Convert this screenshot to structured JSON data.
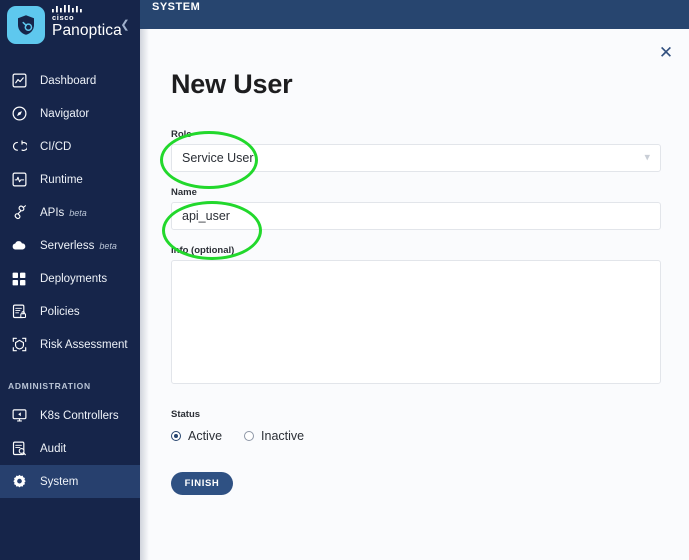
{
  "sidebar": {
    "brand": {
      "cisco_label": "cisco",
      "product_label": "Panoptica",
      "logo_icon": "shield-logo-icon",
      "collapse_icon": "chevron-left-icon"
    },
    "items": [
      {
        "label": "Dashboard",
        "icon": "dashboard-icon",
        "beta": "",
        "active": false
      },
      {
        "label": "Navigator",
        "icon": "compass-icon",
        "beta": "",
        "active": false
      },
      {
        "label": "CI/CD",
        "icon": "cicd-icon",
        "beta": "",
        "active": false
      },
      {
        "label": "Runtime",
        "icon": "runtime-monitor-icon",
        "beta": "",
        "active": false
      },
      {
        "label": "APIs",
        "icon": "api-plug-icon",
        "beta": "beta",
        "active": false
      },
      {
        "label": "Serverless",
        "icon": "cloud-icon",
        "beta": "beta",
        "active": false
      },
      {
        "label": "Deployments",
        "icon": "grid-squares-icon",
        "beta": "",
        "active": false
      },
      {
        "label": "Policies",
        "icon": "policy-lock-icon",
        "beta": "",
        "active": false
      },
      {
        "label": "Risk Assessment",
        "icon": "risk-scan-icon",
        "beta": "",
        "active": false
      }
    ],
    "section_label": "ADMINISTRATION",
    "admin_items": [
      {
        "label": "K8s Controllers",
        "icon": "k8s-monitor-icon",
        "beta": "",
        "active": false
      },
      {
        "label": "Audit",
        "icon": "audit-search-icon",
        "beta": "",
        "active": false
      },
      {
        "label": "System",
        "icon": "gear-icon",
        "beta": "",
        "active": true
      }
    ]
  },
  "topbar": {
    "title": "SYSTEM"
  },
  "panel": {
    "close_icon": "close-icon",
    "title": "New User"
  },
  "form": {
    "role": {
      "label": "Role",
      "value": "Service User",
      "chevron_icon": "chevron-down-icon"
    },
    "name": {
      "label": "Name",
      "value": "api_user",
      "placeholder": ""
    },
    "info": {
      "label": "Info (optional)",
      "value": "",
      "placeholder": ""
    },
    "status": {
      "label": "Status",
      "options": [
        {
          "label": "Active",
          "selected": true
        },
        {
          "label": "Inactive",
          "selected": false
        }
      ]
    },
    "submit_label": "FINISH"
  },
  "annotations": {
    "accent_color": "#22d82c",
    "shapes": [
      {
        "name": "role-field-highlight",
        "target": "Role"
      },
      {
        "name": "name-field-highlight",
        "target": "Name"
      }
    ]
  },
  "colors": {
    "sidebar_bg": "#16254a",
    "sidebar_active": "#27406e",
    "topband_bg": "#27456f",
    "panel_bg": "#fafbfd",
    "brand_logo": "#5ec8ee",
    "button_bg": "#2f5183",
    "annotation_green": "#22d82c"
  }
}
